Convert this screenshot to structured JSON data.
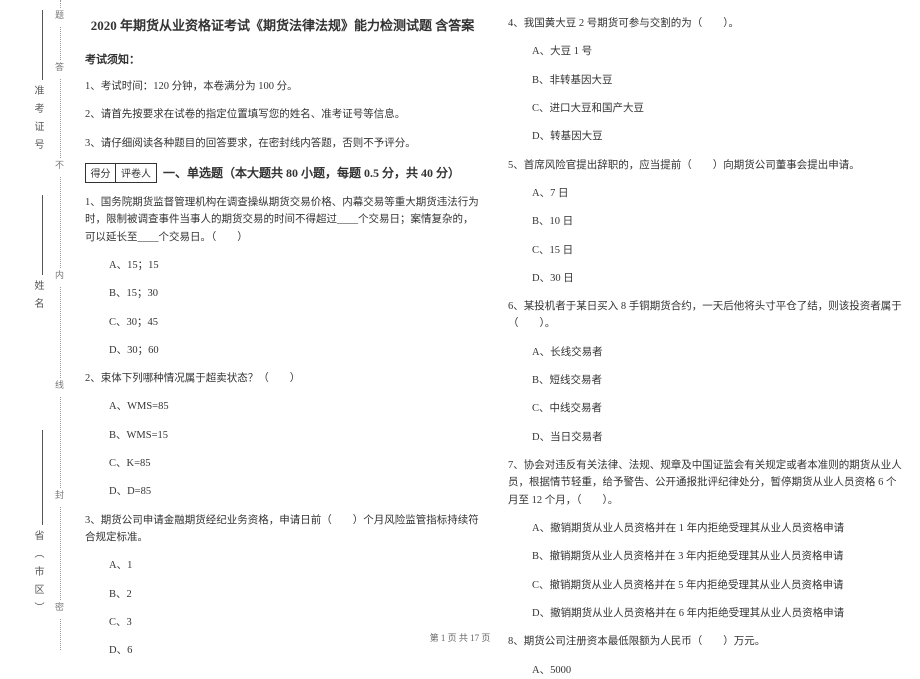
{
  "binding": {
    "labels": [
      "密",
      "封",
      "线",
      "内",
      "不"
    ],
    "side_fields": [
      "省（市区）",
      "姓名",
      "准考证号"
    ],
    "dotted_end_labels": [
      "答",
      "题"
    ]
  },
  "header": {
    "title": "2020 年期货从业资格证考试《期货法律法规》能力检测试题 含答案",
    "instructions_heading": "考试须知：",
    "instructions": [
      "1、考试时间：120 分钟，本卷满分为 100 分。",
      "2、请首先按要求在试卷的指定位置填写您的姓名、准考证号等信息。",
      "3、请仔细阅读各种题目的回答要求，在密封线内答题，否则不予评分。"
    ]
  },
  "scorebox": {
    "left": "得分",
    "right": "评卷人"
  },
  "section1_heading": "一、单选题（本大题共 80 小题，每题 0.5 分，共 40 分）",
  "left_col": {
    "q1": "1、国务院期货监督管理机构在调查操纵期货交易价格、内幕交易等重大期货违法行为时，限制被调查事件当事人的期货交易的时间不得超过____个交易日；案情复杂的，可以延长至____个交易日。（　　）",
    "q1_opts": [
      "A、15；15",
      "B、15；30",
      "C、30；45",
      "D、30；60"
    ],
    "q2": "2、束体下列哪种情况属于超卖状态？（　　）",
    "q2_opts": [
      "A、WMS=85",
      "B、WMS=15",
      "C、K=85",
      "D、D=85"
    ],
    "q3": "3、期货公司申请金融期货经纪业务资格，申请日前（　　）个月风险监管指标持续符合规定标准。",
    "q3_opts": [
      "A、1",
      "B、2",
      "C、3",
      "D、6"
    ]
  },
  "right_col": {
    "q4": "4、我国黄大豆 2 号期货可参与交割的为（　　）。",
    "q4_opts": [
      "A、大豆 1 号",
      "B、非转基因大豆",
      "C、进口大豆和国产大豆",
      "D、转基因大豆"
    ],
    "q5": "5、首席风险官提出辞职的，应当提前（　　）向期货公司董事会提出申请。",
    "q5_opts": [
      "A、7 日",
      "B、10 日",
      "C、15 日",
      "D、30 日"
    ],
    "q6": "6、某投机者于某日买入 8 手铜期货合约，一天后他将头寸平仓了结，则该投资者属于（　　）。",
    "q6_opts": [
      "A、长线交易者",
      "B、短线交易者",
      "C、中线交易者",
      "D、当日交易者"
    ],
    "q7": "7、协会对违反有关法律、法规、规章及中国证监会有关规定或者本准则的期货从业人员，根据情节轻重，给予警告、公开通报批评纪律处分，暂停期货从业人员资格 6 个月至 12 个月，（　　）。",
    "q7_opts": [
      "A、撤销期货从业人员资格并在 1 年内拒绝受理其从业人员资格申请",
      "B、撤销期货从业人员资格并在 3 年内拒绝受理其从业人员资格申请",
      "C、撤销期货从业人员资格并在 5 年内拒绝受理其从业人员资格申请",
      "D、撤销期货从业人员资格并在 6 年内拒绝受理其从业人员资格申请"
    ],
    "q8": "8、期货公司注册资本最低限额为人民币（　　）万元。",
    "q8_opts": [
      "A、5000"
    ]
  },
  "footer": "第 1 页 共 17 页"
}
